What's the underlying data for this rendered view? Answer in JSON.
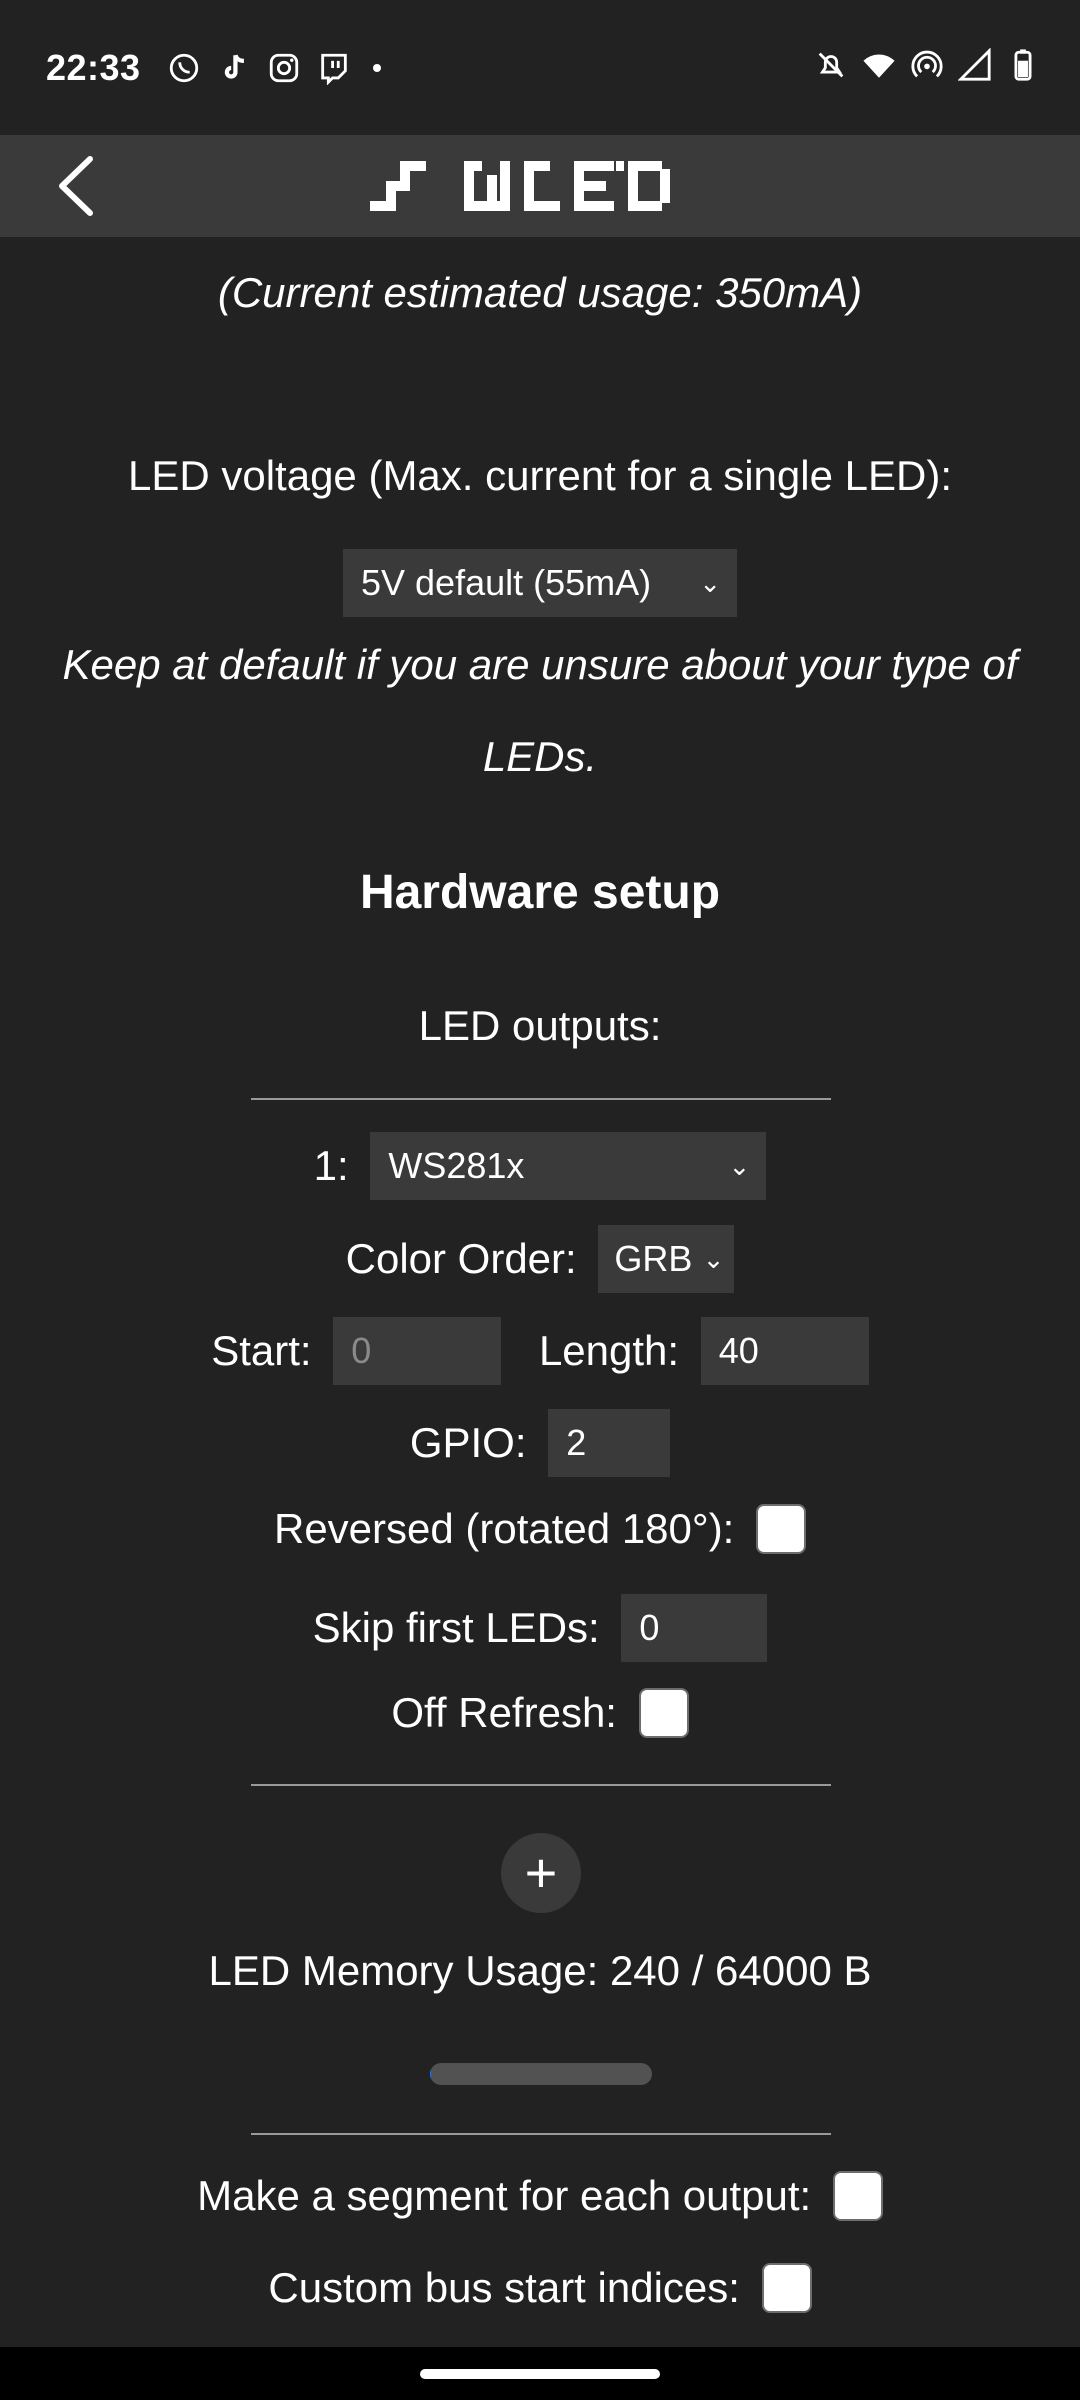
{
  "status_bar": {
    "time": "22:33",
    "app_icons": [
      "whatsapp-icon",
      "tiktok-icon",
      "instagram-icon",
      "twitch-icon"
    ],
    "system_icons": [
      "mute-bell-icon",
      "wifi-icon",
      "hotspot-icon",
      "signal-icon",
      "battery-icon"
    ]
  },
  "app_bar": {
    "logo_alt": "WLED"
  },
  "power": {
    "current_usage": "(Current estimated usage: 350mA)",
    "voltage_label": "LED voltage (Max. current for a single LED):",
    "voltage_selected": "5V default (55mA)",
    "voltage_hint": "Keep at default if you are unsure about your type of",
    "voltage_hint_2": "LEDs."
  },
  "hardware": {
    "heading": "Hardware setup",
    "outputs_label": "LED outputs:",
    "output": {
      "index_label": "1:",
      "type_selected": "WS281x",
      "color_order_label": "Color Order:",
      "color_order_selected": "GRB",
      "start_label": "Start:",
      "start_placeholder": "0",
      "length_label": "Length:",
      "length_value": "40",
      "gpio_label": "GPIO:",
      "gpio_value": "2",
      "reversed_label": "Reversed (rotated 180°):",
      "reversed_checked": false,
      "skip_label": "Skip first LEDs:",
      "skip_value": "0",
      "off_refresh_label": "Off Refresh:",
      "off_refresh_checked": false
    },
    "add_button": "+",
    "memory_usage": "LED Memory Usage: 240 / 64000 B",
    "memory_fraction": 0.00375,
    "segment_each_label": "Make a segment for each output:",
    "custom_bus_label": "Custom bus start indices:"
  },
  "colors": {
    "background": "#222222",
    "app_bar": "#3a3a3a",
    "field": "#3a3a3a",
    "text": "#ffffff"
  }
}
